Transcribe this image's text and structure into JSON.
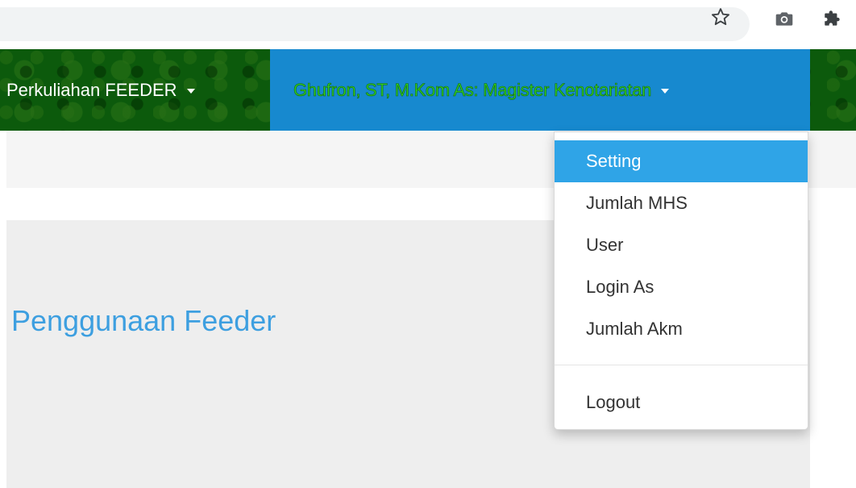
{
  "browser": {
    "toolbar_icons": [
      "star-icon",
      "camera-icon",
      "puzzle-extension-icon"
    ]
  },
  "navbar": {
    "background_color": "#0c5a0c",
    "menu_perkuliahan": "Perkuliahan FEEDER",
    "user_menu": "Ghufron, ST, M.Kom As: Magister Kenotariatan",
    "user_menu_bg": "#1789cf",
    "user_menu_text_color": "#2fd323"
  },
  "dropdown": {
    "items": [
      {
        "label": "Setting",
        "active": true
      },
      {
        "label": "Jumlah MHS"
      },
      {
        "label": "User"
      },
      {
        "label": "Login As"
      },
      {
        "label": "Jumlah Akm"
      }
    ],
    "logout_label": "Logout",
    "active_color": "#2fa4e7"
  },
  "main": {
    "title": "Penggunaan Feeder",
    "title_color": "#3d9fe0"
  }
}
